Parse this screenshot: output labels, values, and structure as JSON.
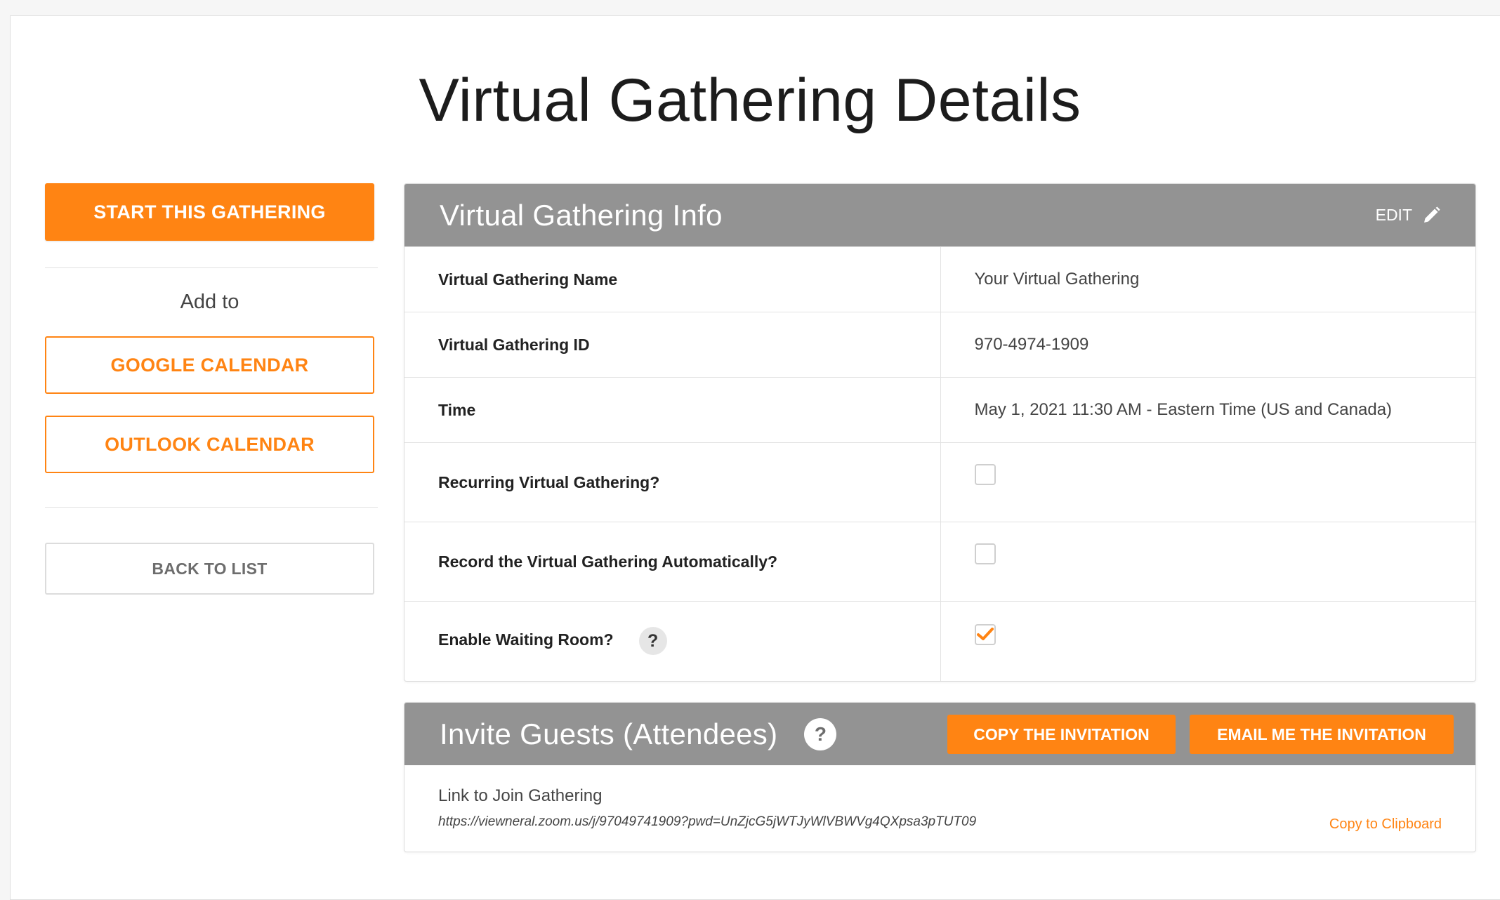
{
  "page": {
    "title": "Virtual Gathering Details"
  },
  "sidebar": {
    "start_label": "START THIS GATHERING",
    "add_to_label": "Add to",
    "google_label": "GOOGLE CALENDAR",
    "outlook_label": "OUTLOOK CALENDAR",
    "back_label": "BACK TO LIST"
  },
  "info": {
    "header_title": "Virtual Gathering Info",
    "edit_label": "EDIT",
    "rows": [
      {
        "label": "Virtual Gathering Name",
        "value": "Your Virtual Gathering"
      },
      {
        "label": "Virtual Gathering ID",
        "value": "970-4974-1909"
      },
      {
        "label": "Time",
        "value": "May 1, 2021 11:30 AM - Eastern Time (US and Canada)"
      },
      {
        "label": "Recurring Virtual Gathering?",
        "checked": false
      },
      {
        "label": "Record the Virtual Gathering Automatically?",
        "checked": false
      },
      {
        "label": "Enable Waiting Room?",
        "checked": true
      }
    ],
    "help_glyph": "?"
  },
  "invite": {
    "header_title": "Invite Guests (Attendees)",
    "help_glyph": "?",
    "copy_label": "COPY THE INVITATION",
    "email_label": "EMAIL ME THE INVITATION",
    "link_label": "Link to Join Gathering",
    "link_url": "https://viewneral.zoom.us/j/97049741909?pwd=UnZjcG5jWTJyWlVBWVg4QXpsa3pTUT09",
    "copy_clipboard_label": "Copy to Clipboard"
  },
  "colors": {
    "accent": "#ff8413",
    "header_gray": "#939393"
  },
  "icons": {
    "edit": "pencil-icon",
    "checked": "checkmark-icon",
    "help": "question-icon"
  }
}
